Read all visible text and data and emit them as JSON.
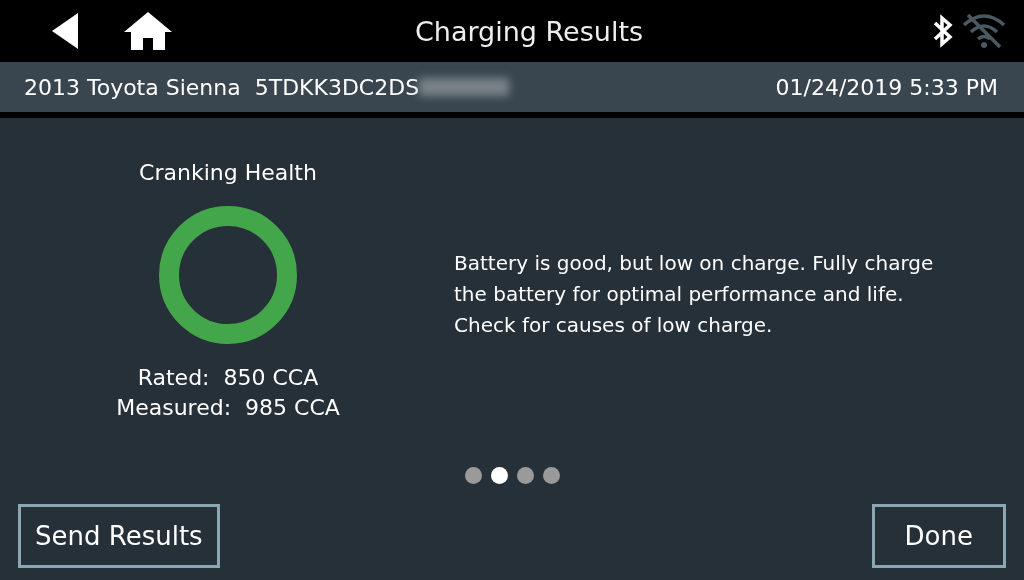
{
  "header": {
    "title": "Charging Results",
    "bluetooth_on": true,
    "wifi_connected": false
  },
  "vehicle_bar": {
    "vehicle": "2013 Toyota Sienna",
    "vin_visible": "5TDKK3DC2DS",
    "vin_redacted": true,
    "datetime": "01/24/2019 5:33 PM"
  },
  "gauge": {
    "title": "Cranking Health",
    "color": "#43a64a",
    "rated": "Rated:  850 CCA",
    "measured": "Measured:  985 CCA"
  },
  "message": "Battery is good, but low on charge. Fully charge the battery for optimal performance and life. Check for causes of low charge.",
  "pages": [
    {
      "selected": false
    },
    {
      "selected": true
    },
    {
      "selected": false
    },
    {
      "selected": false
    }
  ],
  "buttons": {
    "left": "Send Results",
    "right": "Done"
  }
}
